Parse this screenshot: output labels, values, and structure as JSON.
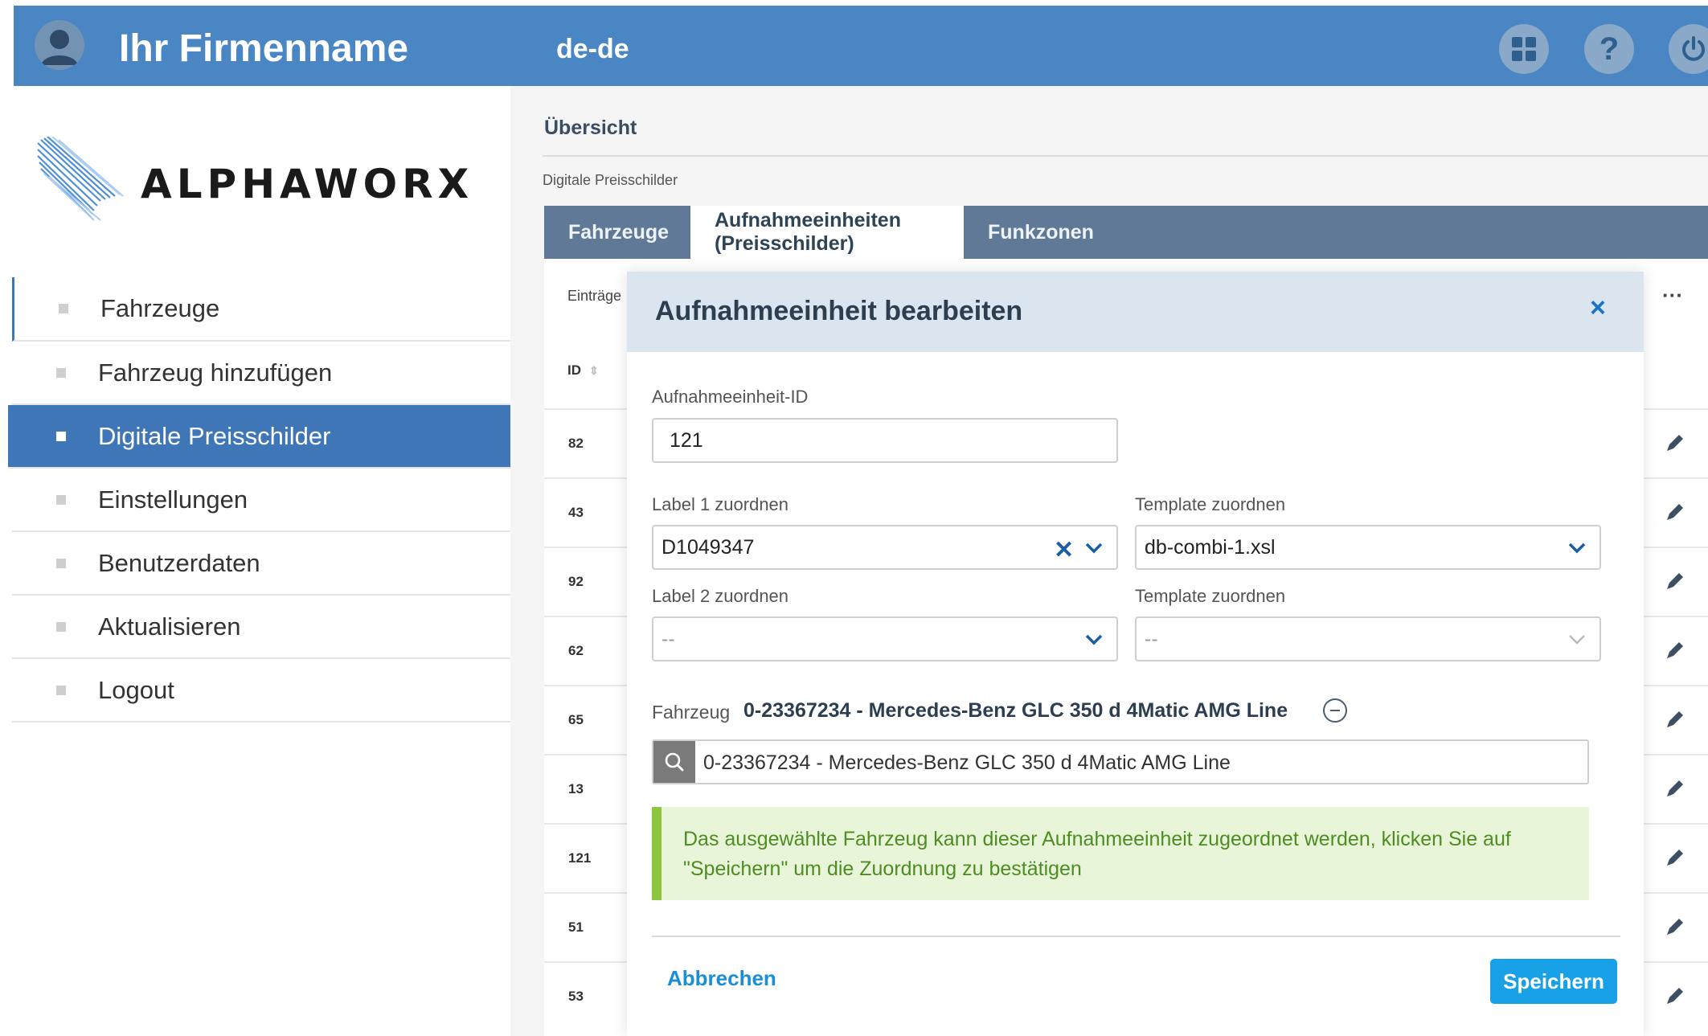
{
  "header": {
    "company_name": "Ihr Firmenname",
    "locale": "de-de",
    "icons": [
      "apps-grid-icon",
      "help-icon",
      "power-icon"
    ],
    "help_glyph": "?",
    "accent_color": "#4a86c3"
  },
  "logo": {
    "text": "ALPHAWORX"
  },
  "sidebar": {
    "items": [
      {
        "label": "Fahrzeuge"
      },
      {
        "label": "Fahrzeug hinzufügen"
      },
      {
        "label": "Digitale Preisschilder"
      },
      {
        "label": "Einstellungen"
      },
      {
        "label": "Benutzerdaten"
      },
      {
        "label": "Aktualisieren"
      },
      {
        "label": "Logout"
      }
    ],
    "active_index": 2,
    "active_color": "#3f76b8"
  },
  "main": {
    "title": "Übersicht",
    "breadcrumb": "Digitale Preisschilder",
    "tabs": [
      {
        "label": "Fahrzeuge"
      },
      {
        "label": "Aufnahmeeinheiten (Preisschilder)"
      },
      {
        "label": "Funkzonen"
      }
    ],
    "active_tab": 1
  },
  "table": {
    "entries_label": "Einträge",
    "more_glyph": "···",
    "id_header": "ID",
    "sort_glyph": "⇕",
    "rows": [
      {
        "id": "82"
      },
      {
        "id": "43"
      },
      {
        "id": "92"
      },
      {
        "id": "62"
      },
      {
        "id": "65"
      },
      {
        "id": "13"
      },
      {
        "id": "121"
      },
      {
        "id": "51"
      },
      {
        "id": "53"
      }
    ]
  },
  "modal": {
    "title": "Aufnahmeeinheit bearbeiten",
    "close_glyph": "×",
    "unit_id_label": "Aufnahmeeinheit-ID",
    "unit_id_value": "121",
    "label1_label": "Label 1 zuordnen",
    "label1_value": "D1049347",
    "template1_label": "Template zuordnen",
    "template1_value": "db-combi-1.xsl",
    "label2_label": "Label 2 zuordnen",
    "label2_value": "--",
    "template2_label": "Template zuordnen",
    "template2_value": "--",
    "clear_glyph": "✕",
    "chevron_glyph": "⌄",
    "vehicle_label": "Fahrzeug",
    "vehicle_name": "0-23367234 - Mercedes-Benz GLC 350 d 4Matic AMG Line",
    "vehicle_search_value": "0-23367234 - Mercedes-Benz GLC 350 d 4Matic AMG Line",
    "alert_text": "Das ausgewählte Fahrzeug kann dieser Aufnahmeeinheit zugeordnet werden, klicken Sie auf \"Speichern\" um die Zuordnung zu bestätigen",
    "cancel_label": "Abbrechen",
    "save_label": "Speichern",
    "save_color": "#19a1e8",
    "alert_color": "#8cc63f"
  }
}
